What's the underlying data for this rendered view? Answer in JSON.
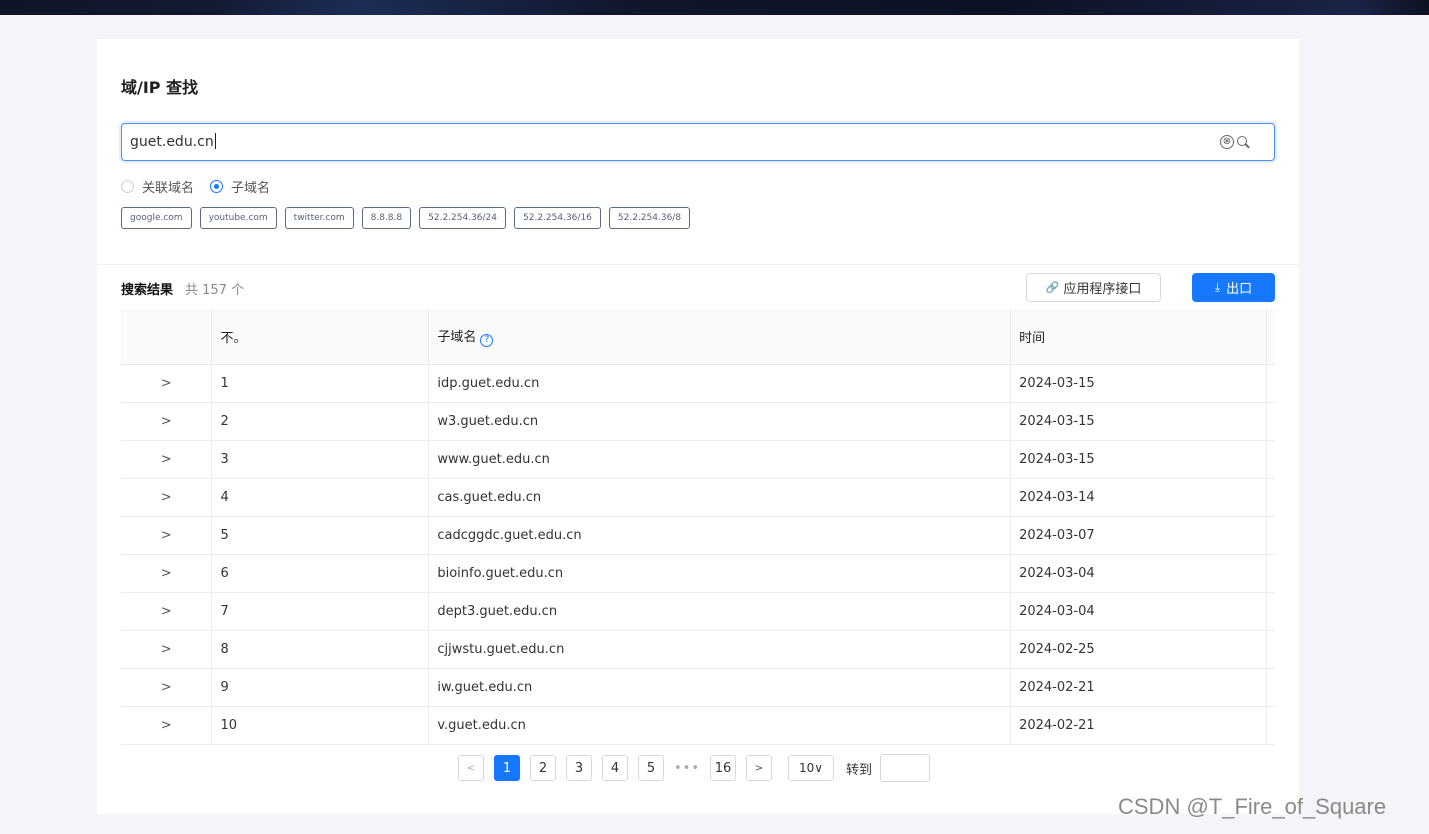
{
  "page": {
    "title": "域/IP 查找"
  },
  "search": {
    "value": "guet.edu.cn",
    "clear_glyph": "⊗"
  },
  "radios": [
    {
      "label": "关联域名",
      "checked": false
    },
    {
      "label": "子域名",
      "checked": true
    }
  ],
  "quick_tags": [
    "google.com",
    "youtube.com",
    "twitter.com",
    "8.8.8.8",
    "52.2.254.36/24",
    "52.2.254.36/16",
    "52.2.254.36/8"
  ],
  "results": {
    "title": "搜索结果",
    "count_text": "共 157 个",
    "api_button": "应用程序接口",
    "export_button": "出口"
  },
  "table": {
    "columns": {
      "no": "不。",
      "subdomain": "子域名",
      "time": "时间"
    },
    "expand_glyph": ">",
    "rows": [
      {
        "no": "1",
        "subdomain": "idp.guet.edu.cn",
        "time": "2024-03-15"
      },
      {
        "no": "2",
        "subdomain": "w3.guet.edu.cn",
        "time": "2024-03-15"
      },
      {
        "no": "3",
        "subdomain": "www.guet.edu.cn",
        "time": "2024-03-15"
      },
      {
        "no": "4",
        "subdomain": "cas.guet.edu.cn",
        "time": "2024-03-14"
      },
      {
        "no": "5",
        "subdomain": "cadcggdc.guet.edu.cn",
        "time": "2024-03-07"
      },
      {
        "no": "6",
        "subdomain": "bioinfo.guet.edu.cn",
        "time": "2024-03-04"
      },
      {
        "no": "7",
        "subdomain": "dept3.guet.edu.cn",
        "time": "2024-03-04"
      },
      {
        "no": "8",
        "subdomain": "cjjwstu.guet.edu.cn",
        "time": "2024-02-25"
      },
      {
        "no": "9",
        "subdomain": "iw.guet.edu.cn",
        "time": "2024-02-21"
      },
      {
        "no": "10",
        "subdomain": "v.guet.edu.cn",
        "time": "2024-02-21"
      }
    ]
  },
  "pagination": {
    "prev": "<",
    "pages": [
      "1",
      "2",
      "3",
      "4",
      "5"
    ],
    "ellipsis": "•••",
    "last": "16",
    "next": ">",
    "page_size": "10∨",
    "goto_label": "转到",
    "current": "1"
  },
  "watermark": "CSDN @T_Fire_of_Square",
  "colors": {
    "primary": "#1677ff",
    "header_bg": "#0f1426"
  }
}
